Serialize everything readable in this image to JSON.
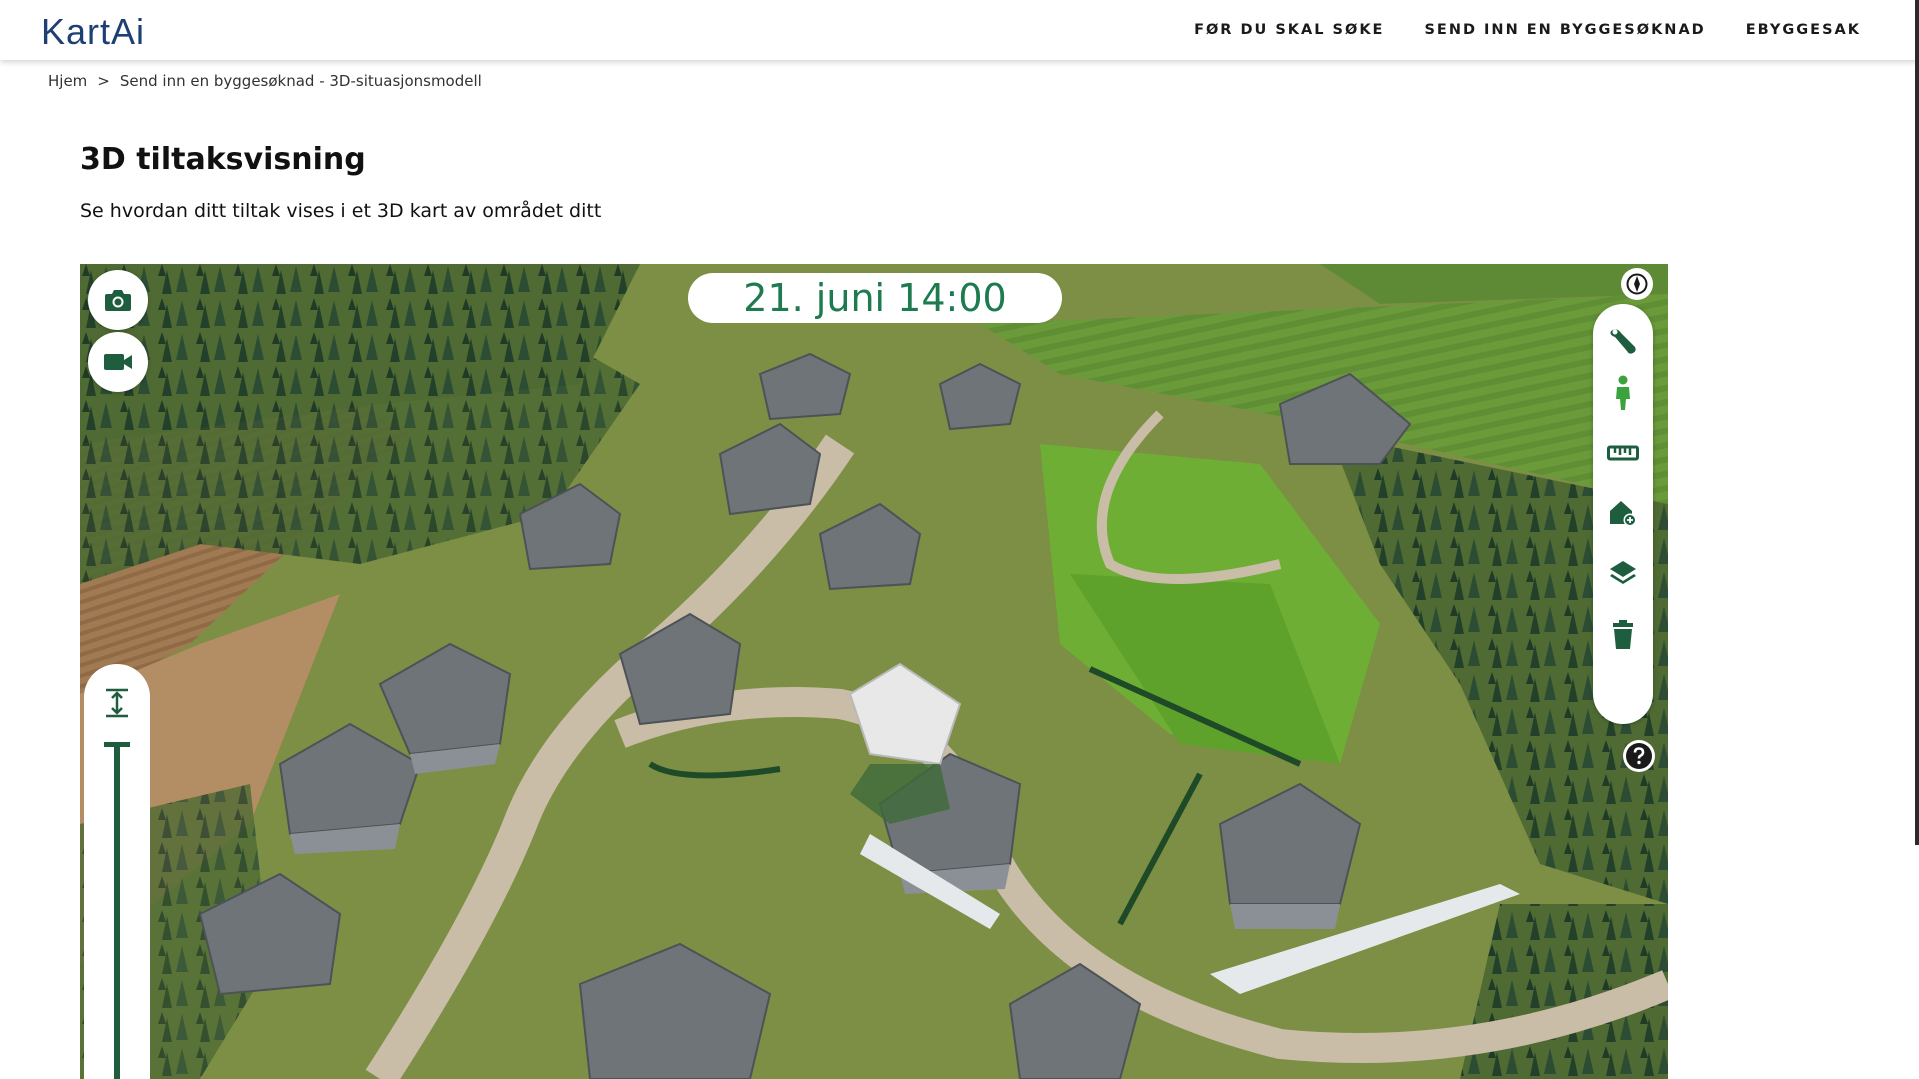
{
  "header": {
    "logo_main": "KartAi",
    "nav": [
      "FØR DU SKAL SØKE",
      "SEND INN EN BYGGESØKNAD",
      "EBYGGESAK"
    ]
  },
  "breadcrumb": {
    "home": "Hjem",
    "separator": ">",
    "current": "Send inn en byggesøknad - 3D-situasjonsmodell"
  },
  "page": {
    "title": "3D tiltaksvisning",
    "subtitle": "Se hvordan ditt tiltak vises i et 3D kart av området ditt"
  },
  "map": {
    "datetime": "21. juni 14:00",
    "tools": [
      "wrench-icon",
      "person-icon",
      "ruler-icon",
      "add-building-icon",
      "layers-icon",
      "trash-icon"
    ],
    "left_buttons": [
      "camera-icon",
      "video-camera-icon"
    ],
    "accent_color": "#1e5e3f",
    "time_color": "#1e7a4f"
  }
}
